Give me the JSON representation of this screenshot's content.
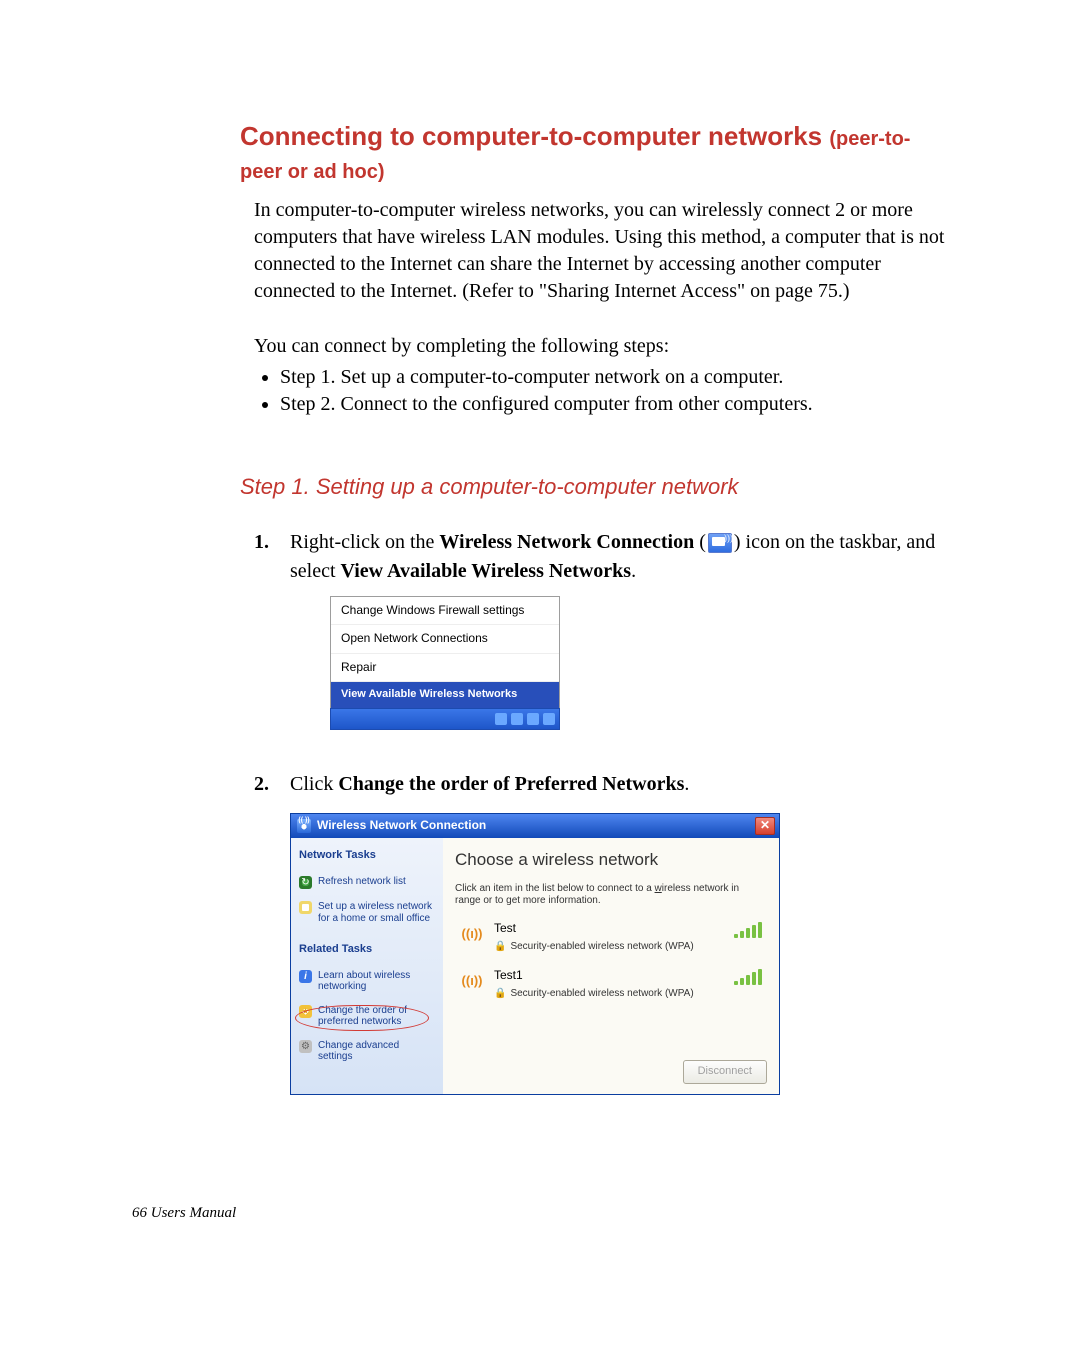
{
  "heading": {
    "main": "Connecting to computer-to-computer networks ",
    "sub": "(peer-to-peer or ad hoc)"
  },
  "intro": "In computer-to-computer wireless networks, you can wirelessly connect 2 or more computers that have wireless LAN modules. Using this method, a computer that is not connected to the Internet can share the Internet by accessing another computer connected to the Internet. (Refer to  \"Sharing Internet Access\" on page 75.)",
  "connect_lead": "You can connect by completing the following steps:",
  "bullets": [
    "Step 1. Set up a computer-to-computer network on a computer.",
    "Step 2. Connect to the configured computer from other computers."
  ],
  "step1_heading": "Step 1. Setting up a computer-to-computer network",
  "steps": [
    {
      "num": "1.",
      "pre": "Right-click on the ",
      "bold1": "Wireless Network Connection",
      "mid": " (",
      "post_icon": ") icon on the taskbar, and select ",
      "bold2": "View Available Wireless Networks",
      "end": "."
    },
    {
      "num": "2.",
      "pre": "Click ",
      "bold1": "Change the order of Preferred Networks",
      "end": "."
    }
  ],
  "ctx_menu": {
    "items": [
      "Change Windows Firewall settings",
      "Open Network Connections",
      "Repair",
      "View Available Wireless Networks"
    ]
  },
  "dialog": {
    "title": "Wireless Network Connection",
    "sidebar": {
      "heading1": "Network Tasks",
      "links1": [
        "Refresh network list",
        "Set up a wireless network for a home or small office"
      ],
      "heading2": "Related Tasks",
      "links2": [
        "Learn about wireless networking",
        "Change the order of preferred networks",
        "Change advanced settings"
      ]
    },
    "main": {
      "title": "Choose a wireless network",
      "desc_pre": "Click an item in the list below to connect to a ",
      "desc_u": "w",
      "desc_post": "ireless network in range or to get more information.",
      "networks": [
        {
          "name": "Test",
          "sec": "Security-enabled wireless network (WPA)"
        },
        {
          "name": "Test1",
          "sec": "Security-enabled wireless network (WPA)"
        }
      ],
      "button": "Disconnect"
    }
  },
  "footer": "66  Users Manual"
}
